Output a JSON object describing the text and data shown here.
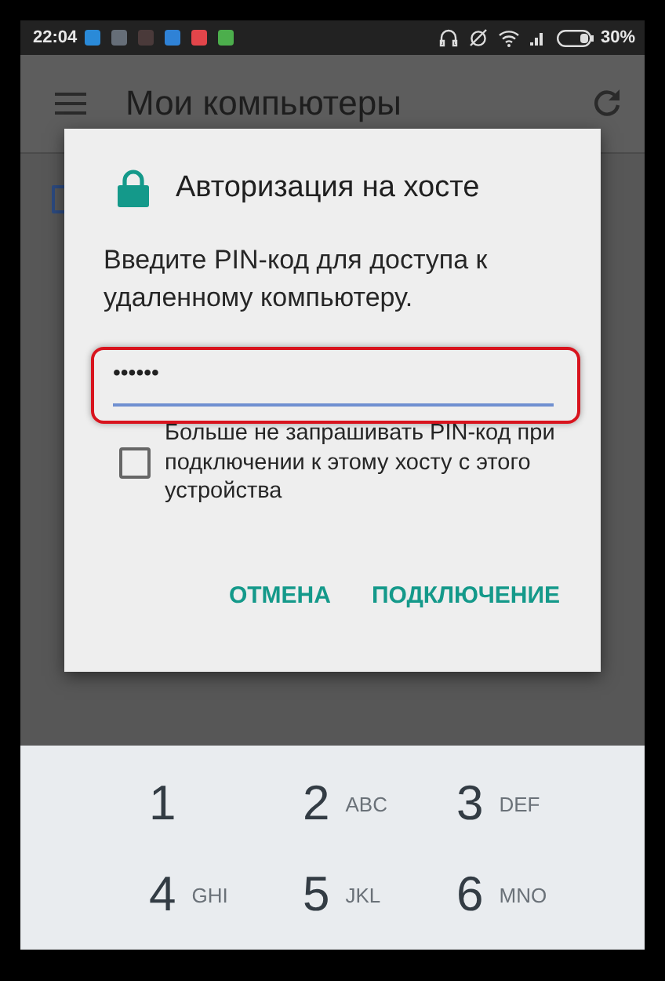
{
  "status_bar": {
    "time": "22:04",
    "battery_text": "30%"
  },
  "app_bar": {
    "title": "Мои компьютеры"
  },
  "dialog": {
    "title": "Авторизация на хосте",
    "message": "Введите PIN-код для доступа к удаленному компьютеру.",
    "pin_field": {
      "value": "••••••"
    },
    "remember": {
      "label": "Больше не запрашивать PIN-код при подключении к этому хосту с этого устройства",
      "checked": false
    },
    "buttons": [
      "ОТМЕНА",
      "ПОДКЛЮЧЕНИЕ"
    ]
  },
  "keypad": {
    "keys": [
      {
        "digit": "1"
      },
      {
        "digit": "2",
        "letters": "ABC"
      },
      {
        "digit": "3",
        "letters": "DEF"
      },
      {
        "digit": "4",
        "letters": "GHI"
      },
      {
        "digit": "5",
        "letters": "JKL"
      },
      {
        "digit": "6",
        "letters": "MNO"
      }
    ]
  }
}
